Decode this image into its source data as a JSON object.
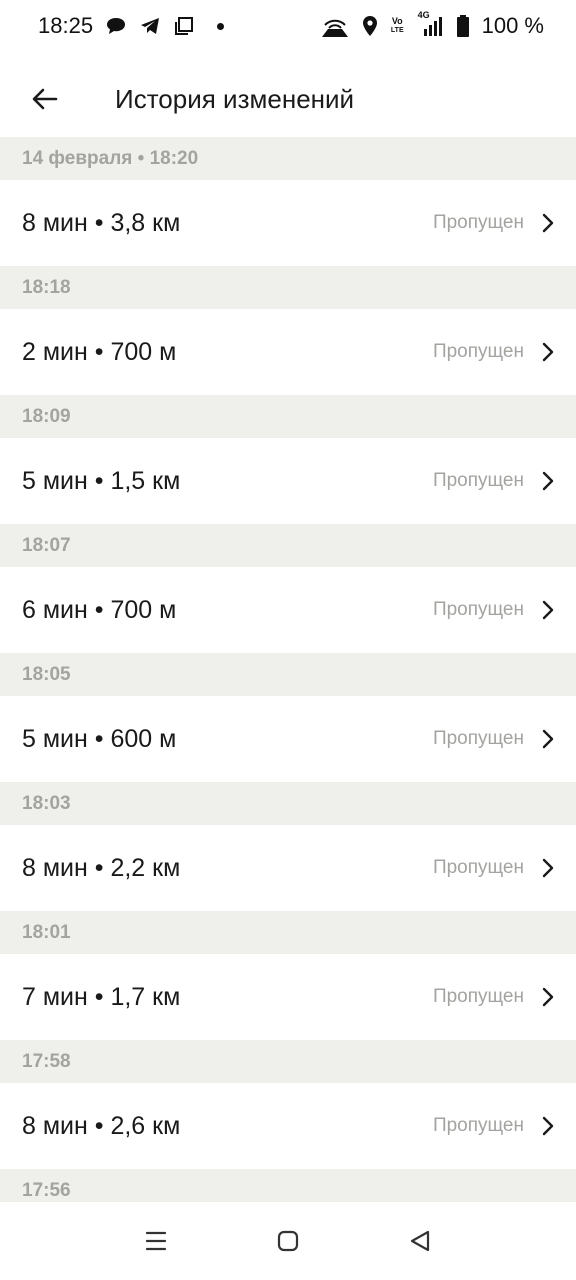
{
  "status_bar": {
    "time": "18:25",
    "network_label_top": "Vo",
    "network_label_bottom": "LTE",
    "network_type": "4G",
    "battery": "100 %",
    "icons": [
      "chat-bubble-icon",
      "telegram-icon",
      "copy-icon",
      "dot-icon",
      "hotspot-icon",
      "location-icon",
      "volte-icon",
      "signal-icon",
      "battery-icon"
    ]
  },
  "header": {
    "title": "История изменений",
    "back_icon": "arrow-left-icon"
  },
  "history": [
    {
      "time_label": "14 февраля • 18:20",
      "summary": "8 мин • 3,8 км",
      "status": "Пропущен"
    },
    {
      "time_label": "18:18",
      "summary": "2 мин • 700 м",
      "status": "Пропущен"
    },
    {
      "time_label": "18:09",
      "summary": "5 мин • 1,5 км",
      "status": "Пропущен"
    },
    {
      "time_label": "18:07",
      "summary": "6 мин • 700 м",
      "status": "Пропущен"
    },
    {
      "time_label": "18:05",
      "summary": "5 мин • 600 м",
      "status": "Пропущен"
    },
    {
      "time_label": "18:03",
      "summary": "8 мин • 2,2 км",
      "status": "Пропущен"
    },
    {
      "time_label": "18:01",
      "summary": "7 мин • 1,7 км",
      "status": "Пропущен"
    },
    {
      "time_label": "17:58",
      "summary": "8 мин • 2,6 км",
      "status": "Пропущен"
    },
    {
      "time_label": "17:56"
    }
  ],
  "nav_bar": {
    "icons": [
      "menu-icon",
      "home-icon",
      "back-triangle-icon"
    ]
  },
  "colors": {
    "group_header_bg": "#efefec",
    "muted_text": "#a3a3a0",
    "primary_text": "#1a1a1a"
  }
}
